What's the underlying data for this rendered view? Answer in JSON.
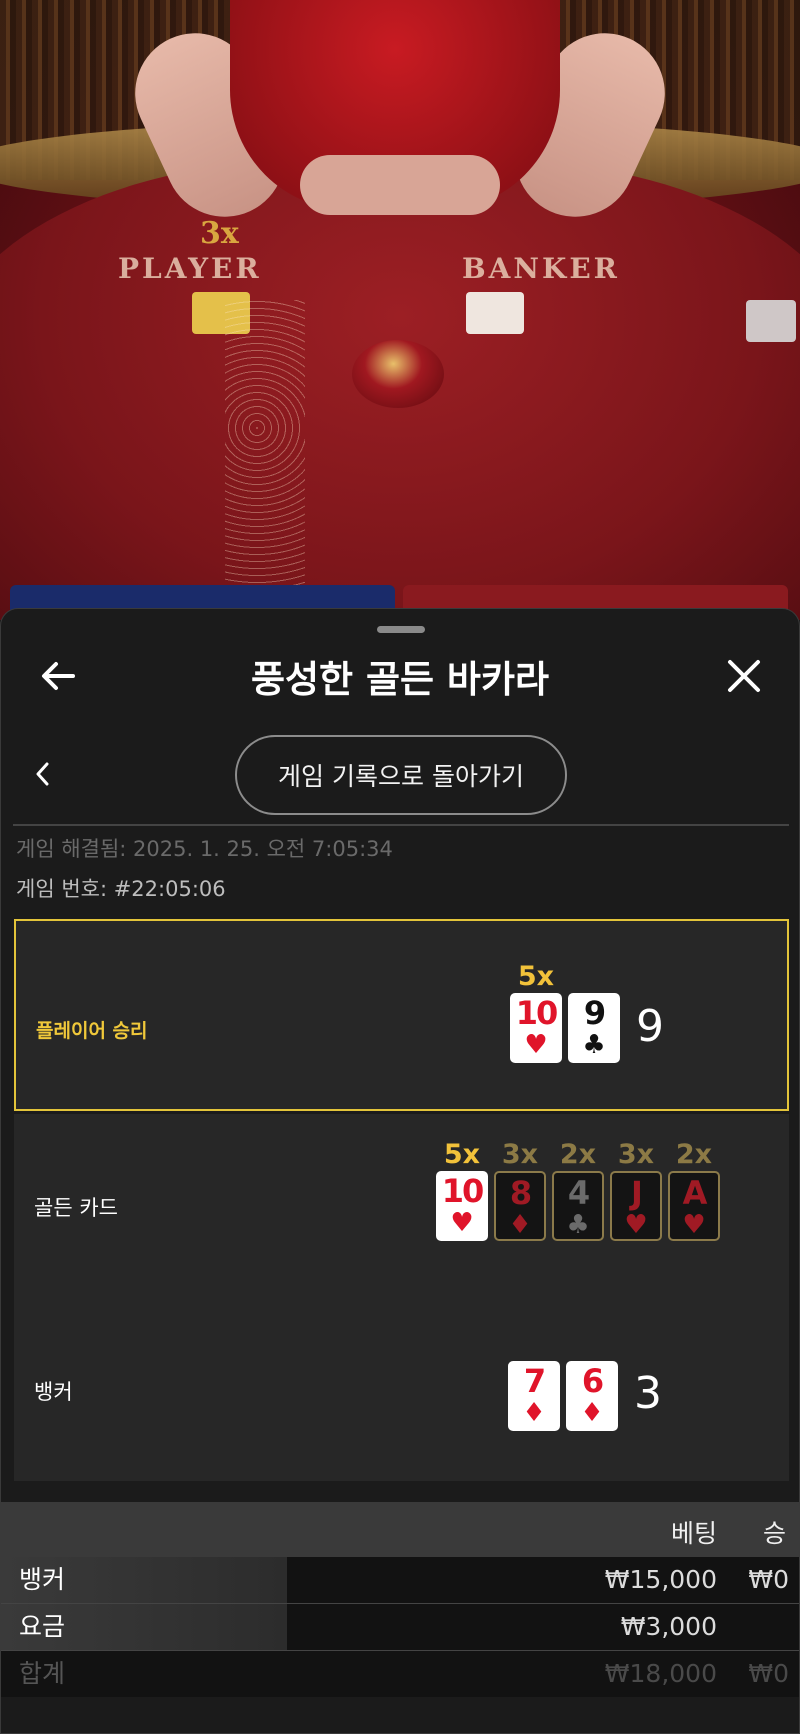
{
  "video": {
    "felt_multiplier": "3x",
    "player_label": "PLAYER",
    "banker_label": "BANKER"
  },
  "header": {
    "title": "풍성한 골든 바카라",
    "back_icon": "arrow-left-icon",
    "close_icon": "close-icon"
  },
  "nav": {
    "back_icon": "chevron-left-icon",
    "history_button": "게임 기록으로 돌아가기"
  },
  "meta": {
    "resolved": "게임 해결됨: 2025. 1. 25. 오전 7:05:34",
    "game_number": "게임 번호: #22:05:06"
  },
  "results": {
    "player": {
      "label": "플레이어 승리",
      "score": "9",
      "cards": [
        {
          "rank": "10",
          "suit": "♥",
          "color": "red",
          "mult": "5x"
        },
        {
          "rank": "9",
          "suit": "♣",
          "color": "black",
          "mult": ""
        }
      ]
    },
    "golden": {
      "label": "골든 카드",
      "cards": [
        {
          "rank": "10",
          "suit": "♥",
          "color": "red",
          "mult": "5x",
          "active": true
        },
        {
          "rank": "8",
          "suit": "♦",
          "color": "red",
          "mult": "3x",
          "active": false
        },
        {
          "rank": "4",
          "suit": "♣",
          "color": "black",
          "mult": "2x",
          "active": false
        },
        {
          "rank": "J",
          "suit": "♥",
          "color": "red",
          "mult": "3x",
          "active": false
        },
        {
          "rank": "A",
          "suit": "♥",
          "color": "red",
          "mult": "2x",
          "active": false
        }
      ]
    },
    "banker": {
      "label": "뱅커",
      "score": "3",
      "cards": [
        {
          "rank": "7",
          "suit": "♦",
          "color": "red"
        },
        {
          "rank": "6",
          "suit": "♦",
          "color": "red"
        }
      ]
    }
  },
  "bets": {
    "headers": {
      "bet": "베팅",
      "win": "승"
    },
    "rows": [
      {
        "label": "뱅커",
        "bet": "₩15,000",
        "win": "₩0"
      },
      {
        "label": "요금",
        "bet": "₩3,000",
        "win": ""
      },
      {
        "label": "합계",
        "bet": "₩18,000",
        "win": "₩0"
      }
    ]
  },
  "colors": {
    "accent_gold": "#f2c23a",
    "win_border": "#e3c43a",
    "card_red": "#e0142a"
  }
}
